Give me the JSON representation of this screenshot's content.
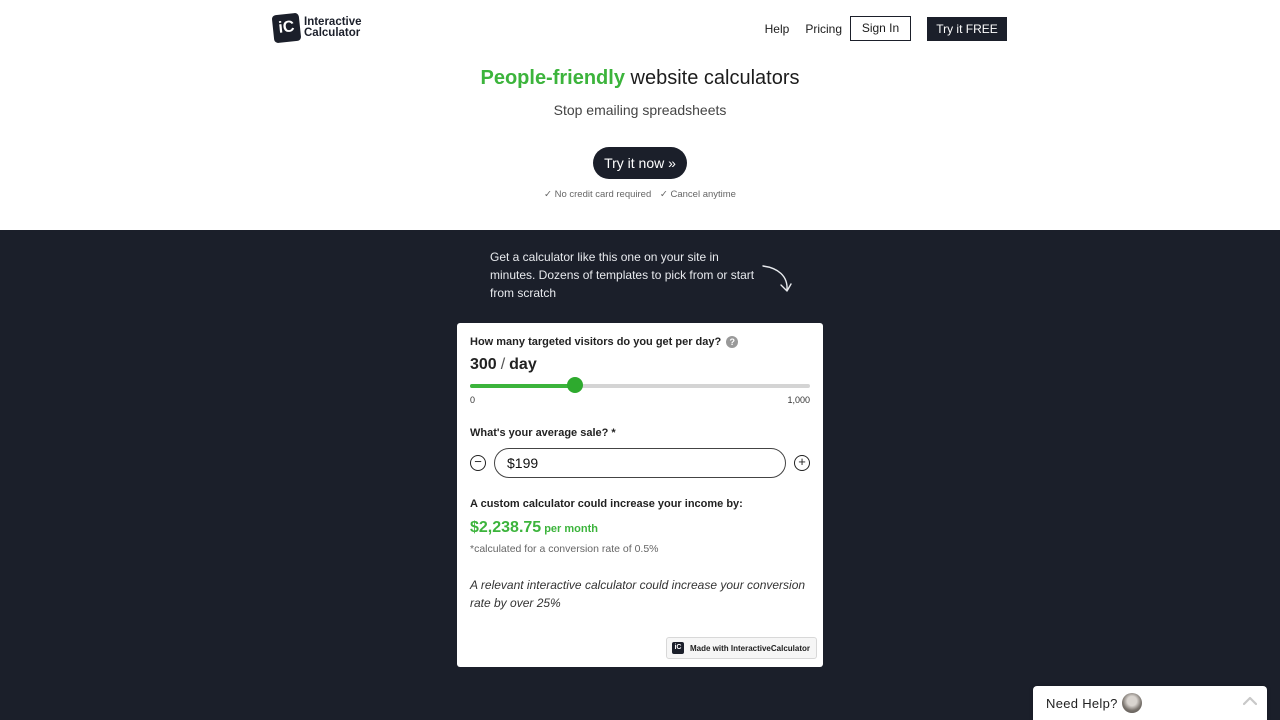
{
  "header": {
    "logo_mark": "iC",
    "logo_line1": "Interactive",
    "logo_line2": "Calculator",
    "nav": {
      "help": "Help",
      "pricing": "Pricing",
      "sign_in": "Sign In",
      "try_free": "Try it FREE"
    }
  },
  "hero": {
    "title_accent": "People-friendly",
    "title_rest": "website calculators",
    "subtitle": "Stop emailing spreadsheets",
    "cta": "Try it now »",
    "note1": "✓ No credit card required",
    "note2": "✓ Cancel anytime"
  },
  "promo": {
    "text": "Get a calculator like this one on your site in minutes. Dozens of templates to pick from or start from scratch"
  },
  "calculator": {
    "q1": "How many targeted visitors do you get per day?",
    "help_icon": "?",
    "visitors_value": "300",
    "visitors_sep": "/",
    "visitors_unit": "day",
    "slider": {
      "min": 0,
      "max": 1000,
      "value": 300,
      "min_label": "0",
      "max_label": "1,000"
    },
    "q2": "What's your average sale? *",
    "sale_value": "$199",
    "minus_icon": "−",
    "plus_icon": "+",
    "result_label": "A custom calculator could increase your income by:",
    "result_value": "$2,238.75",
    "result_unit": "per month",
    "result_note": "*calculated for a conversion rate of 0.5%",
    "quote": "A relevant interactive calculator could increase your conversion rate by over 25%",
    "made_with_mark": "iC",
    "made_with": "Made with InteractiveCalculator"
  },
  "help_widget": {
    "label": "Need Help?"
  },
  "colors": {
    "accent_green": "#3cb43c",
    "dark_bg": "#1b1f2a"
  }
}
